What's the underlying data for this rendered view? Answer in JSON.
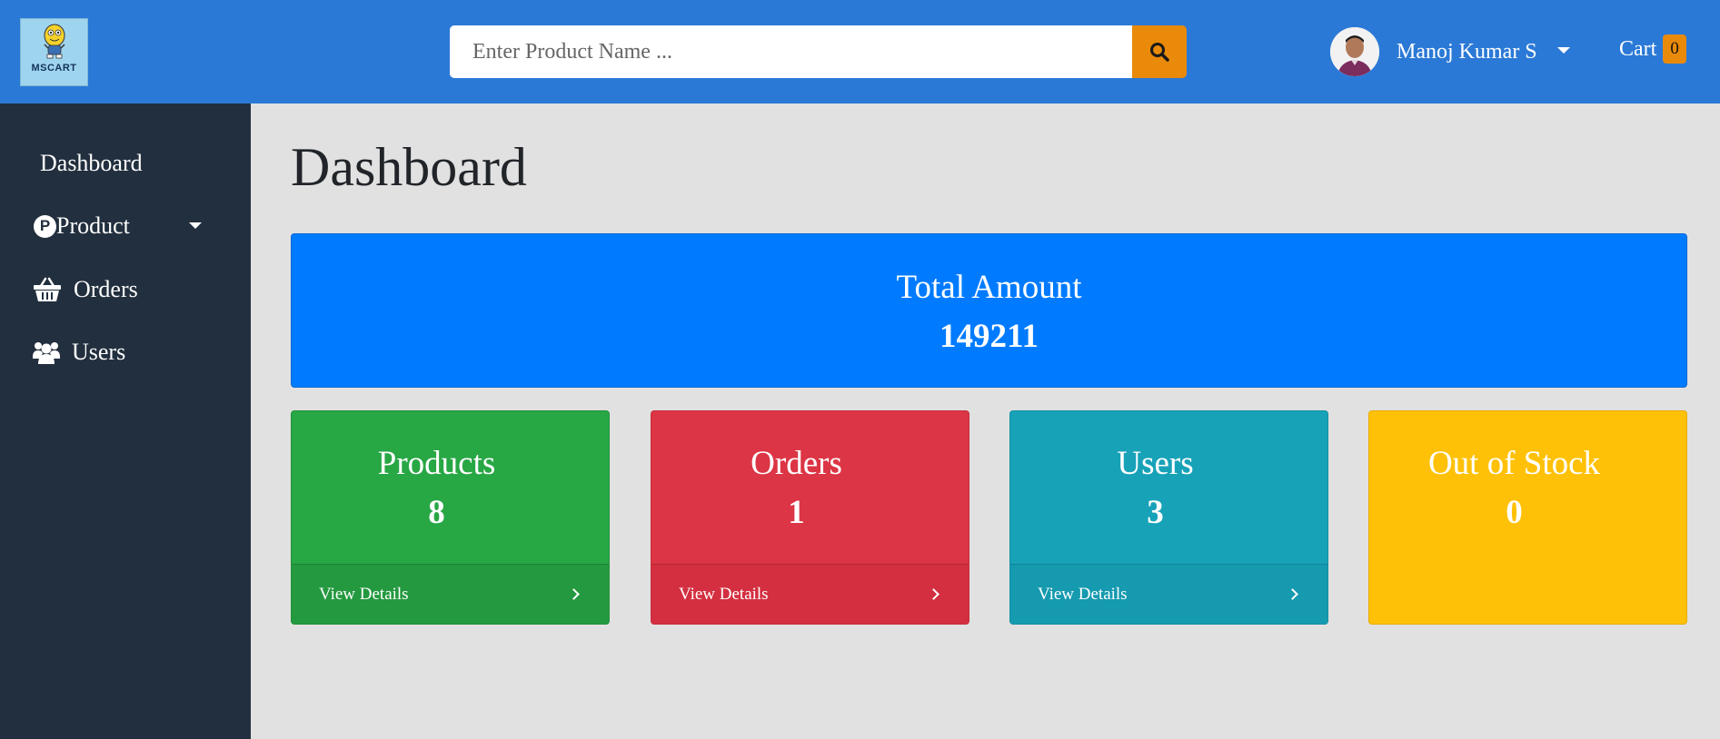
{
  "brand": {
    "logo_text": "MSCART"
  },
  "search": {
    "placeholder": "Enter Product Name ..."
  },
  "user": {
    "name": "Manoj Kumar S"
  },
  "cart": {
    "label": "Cart",
    "count": "0"
  },
  "sidebar": {
    "items": [
      {
        "label": "Dashboard",
        "icon": "none"
      },
      {
        "label": "Product",
        "icon": "p-circle-icon",
        "badge_letter": "P"
      },
      {
        "label": "Orders",
        "icon": "basket-icon"
      },
      {
        "label": "Users",
        "icon": "users-icon"
      }
    ]
  },
  "main": {
    "title": "Dashboard",
    "total": {
      "label": "Total Amount",
      "value": "149211"
    },
    "cards": [
      {
        "title": "Products",
        "value": "8",
        "footer": "View Details",
        "color": "#28a745"
      },
      {
        "title": "Orders",
        "value": "1",
        "footer": "View Details",
        "color": "#dc3545"
      },
      {
        "title": "Users",
        "value": "3",
        "footer": "View Details",
        "color": "#17a2b8"
      },
      {
        "title": "Out of Stock",
        "value": "0",
        "color": "#ffc107"
      }
    ]
  },
  "colors": {
    "header": "#2b79d6",
    "sidebar": "#222f3e",
    "accent": "#e98a0a",
    "total_bg": "#007bff",
    "background": "#e1e1e1"
  }
}
